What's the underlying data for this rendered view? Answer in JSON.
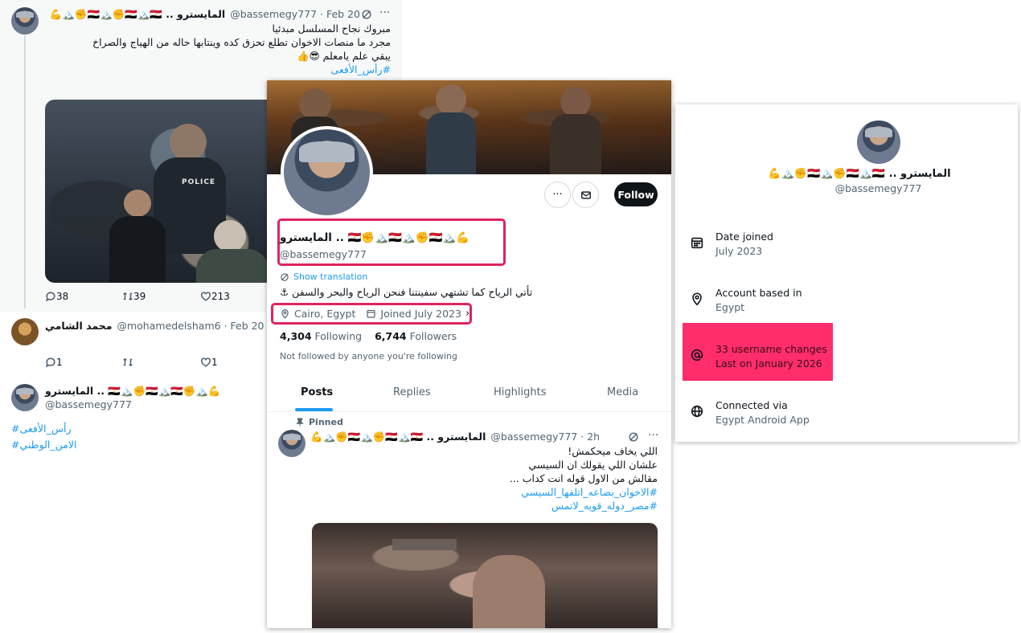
{
  "left_col": {
    "tweet1": {
      "name": "المايسترو .. 🇪🇬🏔️✊🇪🇬🏔️🇪🇬✊🏔️💪",
      "handle_date": "@bassemegy777 · Feb 20",
      "lines": [
        "مبروك نجاح المسلسل مبدئيا",
        "مجرد ما منصات الاخوان تطلع تحزق كده وينتابها حاله من الهياج والصراخ",
        "يبقي علم يامعلم 😎👍",
        "#رأس_الأفعى"
      ],
      "poster_text": "POLICE",
      "replies": "38",
      "retweets": "39",
      "likes": "213"
    },
    "tweet2": {
      "name": "محمد الشامي",
      "handle_date": "@mohamedelsham6 · Feb 20",
      "replies": "1",
      "likes": "1"
    },
    "tweet3": {
      "name": "المايسترو .. 🇪🇬🏔️✊🇪🇬🏔️🇪🇬✊🏔️💪",
      "handle": "@bassemegy777",
      "hashtags": [
        "#رأس_الأفعى",
        "#الامن_الوطني"
      ]
    }
  },
  "profile": {
    "name": "المايسترو .. 🇪🇬✊🏔️🇪🇬🏔️✊🇪🇬🏔️💪",
    "handle": "@bassemegy777",
    "show_translation": "Show translation",
    "bio": "تأتي الرياح كما تشتهي سفينتنا فنحن الرياح والبحر والسفن ⚓",
    "location": "Cairo, Egypt",
    "joined": "Joined July 2023",
    "following_count": "4,304",
    "following_label": "Following",
    "followers_count": "6,744",
    "followers_label": "Followers",
    "not_followed": "Not followed by anyone you're following",
    "follow_button": "Follow",
    "tabs": [
      "Posts",
      "Replies",
      "Highlights",
      "Media"
    ],
    "pinned_label": "Pinned",
    "pinned_name": "المايسترو .. 🇪🇬🏔️✊🇪🇬🏔️🇪🇬✊🏔️💪",
    "pinned_handle_time": "@bassemegy777 · 2h",
    "pinned_lines": [
      "اللي يخاف ميحكمش!",
      "علشان اللي يقولك ان السيسي",
      "مقالش من الاول قوله انت كداب ...",
      "#الاخوان_بضاعه_اتلفها_السيسي",
      "#مصر_دوله_قويه_لاتمس"
    ]
  },
  "about": {
    "name": "المايسترو .. 🇪🇬🏔️✊🇪🇬🏔️🇪🇬✊🏔️💪",
    "handle": "@bassemegy777",
    "rows": [
      {
        "label": "Date joined",
        "value": "July 2023"
      },
      {
        "label": "Account based in",
        "value": "Egypt"
      },
      {
        "label": "33 username changes",
        "value": "Last on January 2026"
      },
      {
        "label": "Connected via",
        "value": "Egypt Android App"
      }
    ]
  },
  "colors": {
    "accent": "#1d9bf0",
    "highlight": "#e0245e",
    "highlight_fill": "#ff2d6a",
    "text": "#0f1419",
    "muted": "#536471"
  }
}
